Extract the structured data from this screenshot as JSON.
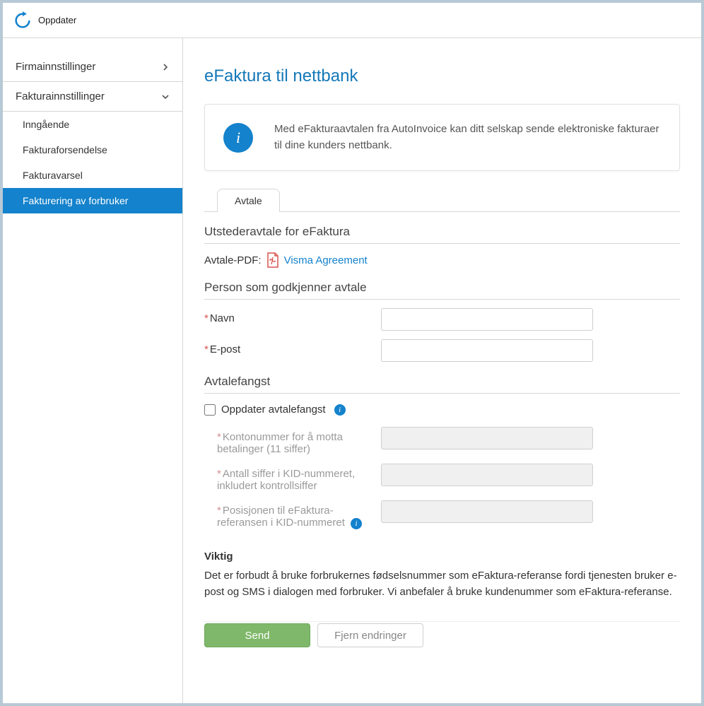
{
  "topbar": {
    "refresh_label": "Oppdater"
  },
  "sidebar": {
    "sections": [
      {
        "label": "Firmainnstillinger",
        "expanded": false
      },
      {
        "label": "Fakturainnstillinger",
        "expanded": true
      }
    ],
    "items": [
      {
        "label": "Inngående"
      },
      {
        "label": "Fakturaforsendelse"
      },
      {
        "label": "Fakturavarsel"
      },
      {
        "label": "Fakturering av forbruker"
      }
    ]
  },
  "page": {
    "title": "eFaktura til nettbank",
    "info_text": "Med eFakturaavtalen fra AutoInvoice kan ditt selskap sende elektroniske fakturaer til dine kunders nettbank.",
    "tab_label": "Avtale"
  },
  "section1": {
    "title": "Utstederavtale for eFaktura",
    "pdf_label": "Avtale-PDF:",
    "pdf_link": "Visma Agreement"
  },
  "section2": {
    "title": "Person som godkjenner avtale",
    "name_label": "Navn",
    "email_label": "E-post",
    "name_value": "",
    "email_value": ""
  },
  "section3": {
    "title": "Avtalefangst",
    "checkbox_label": "Oppdater avtalefangst",
    "account_label": "Kontonummer for å motta betalinger (11 siffer)",
    "kid_digits_label": "Antall siffer i KID-nummeret, inkludert kontrollsiffer",
    "kid_pos_label": "Posisjonen til eFaktura-referansen i KID-nummeret",
    "account_value": "",
    "kid_digits_value": "",
    "kid_pos_value": ""
  },
  "important": {
    "title": "Viktig",
    "text": "Det er forbudt å bruke forbrukernes fødselsnummer som eFaktura-referanse fordi tjenesten bruker e-post og SMS i dialogen med forbruker. Vi anbefaler å bruke kundenummer som eFaktura-referanse."
  },
  "buttons": {
    "send": "Send",
    "discard": "Fjern endringer"
  }
}
